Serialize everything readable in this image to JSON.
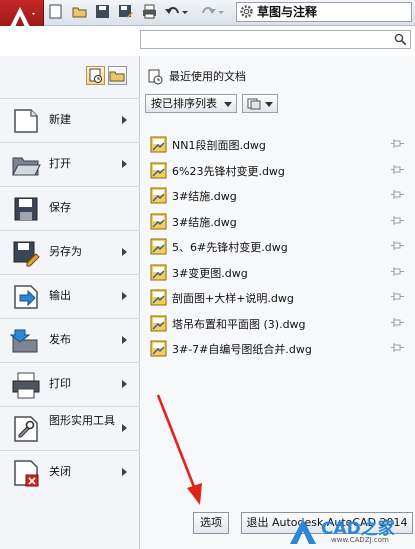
{
  "workspace": {
    "name": "草图与注释"
  },
  "search": {
    "placeholder": ""
  },
  "left_menu": [
    {
      "label": "新建",
      "icon": "new-file-icon",
      "has_submenu": true
    },
    {
      "label": "打开",
      "icon": "folder-open-icon",
      "has_submenu": true
    },
    {
      "label": "保存",
      "icon": "floppy-disk-icon",
      "has_submenu": false
    },
    {
      "label": "另存为",
      "icon": "save-as-icon",
      "has_submenu": true
    },
    {
      "label": "输出",
      "icon": "export-icon",
      "has_submenu": true
    },
    {
      "label": "发布",
      "icon": "publish-icon",
      "has_submenu": true
    },
    {
      "label": "打印",
      "icon": "printer-icon",
      "has_submenu": true
    },
    {
      "label": "图形实用工具",
      "icon": "drawing-utilities-icon",
      "has_submenu": true
    },
    {
      "label": "关闭",
      "icon": "close-drawing-icon",
      "has_submenu": true
    }
  ],
  "recent": {
    "title": "最近使用的文档",
    "sort_label": "按已排序列表",
    "files": [
      "NN1段剖面图.dwg",
      "6%23先锋村变更.dwg",
      "3#结施.dwg",
      "3#结施.dwg",
      "5、6#先锋村变更.dwg",
      "3#变更图.dwg",
      "剖面图+大样+说明.dwg",
      "塔吊布置和平面图 (3).dwg",
      "3#-7#自编号图纸合并.dwg"
    ]
  },
  "buttons": {
    "options": "选项",
    "exit": "退出 Autodesk AutoCAD 2014"
  },
  "watermark": {
    "brand": "CAD之家",
    "url": "www.CADZJ.com"
  },
  "colors": {
    "app_button": "#b71c1c",
    "accent_arrow": "#e0241b",
    "brand_blue": "#2d86d8"
  }
}
